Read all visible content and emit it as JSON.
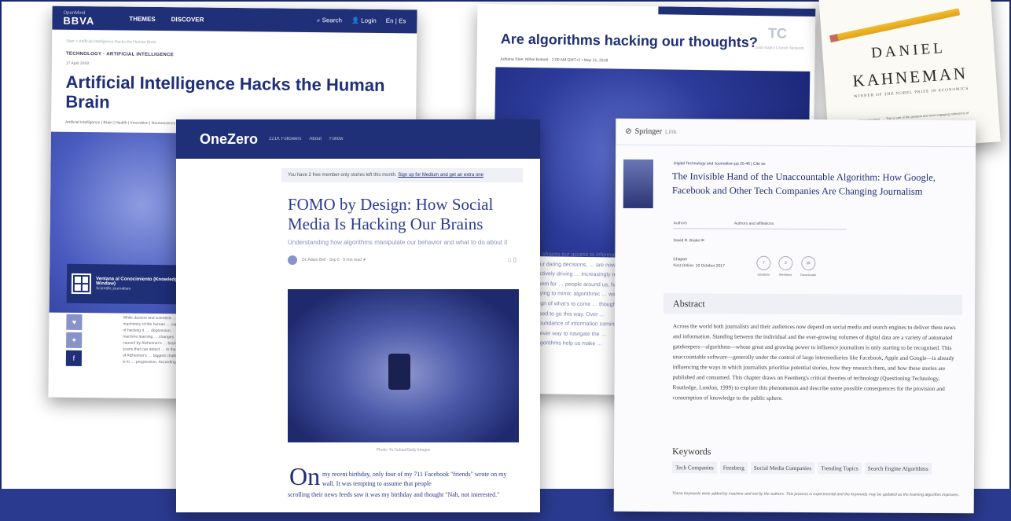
{
  "bbva": {
    "brand_sup": "OpenMind",
    "brand_logo": "BBVA",
    "nav_themes": "THEMES",
    "nav_discover": "DISCOVER",
    "nav_search": "Search",
    "nav_login": "Login",
    "nav_lang": "En | Es",
    "breadcrumb": "Start > Artificial Intelligence Hacks the Human Brain",
    "tags": "TECHNOLOGY · ARTIFICIAL INTELLIGENCE",
    "date": "17 April 2018",
    "title": "Artificial Intelligence Hacks the Human Brain",
    "categories": "Artificial Intelligence | Brain | Health | Innovation | Neuroscience",
    "author_name": "Ventana al Conocimiento (Knowledge Window)",
    "author_role": "Scientific journalism",
    "body": "While doctors and scientists … machinery of the human … capable of hacking it. … depression, machine learning … changes caused by Alzheimer's … brain scans that can detect … In the case of Alzheimer's … biggest challenge is to … progression. Accordingly …"
  },
  "algo": {
    "title": "Are algorithms hacking our thoughts?",
    "tc_logo": "TC",
    "tc_author": "Josh Kaltro Crunch Network",
    "authors": "Adriana Stan, Mihai Botarel · 2:00 AM GMT+2 • May 21, 2018",
    "text": "…shapes our access to information … our dating decisions, … are now actively driving … increasingly rely on them for … people around us, have … trying to mimic algorithmic … warning sign of what's to come … thoughts? … used to go this way. Over … abundance of information coming … a clever way to navigate the … algorithms help us make …"
  },
  "book": {
    "first_name": "DANIEL",
    "last_name": "KAHNEMAN",
    "prize": "WINNER OF THE NOBEL PRIZE IN ECONOMICS",
    "quote": "\"A masterpiece . . . This is one of the greatest and most engaging collections of"
  },
  "onezero": {
    "logo": "OneZero",
    "followers": "221K Followers",
    "about": "About",
    "follow": "Follow",
    "notice": "You have 2 free member-only stories left this month.",
    "notice_link": "Sign up for Medium and get an extra one",
    "title": "FOMO by Design: How Social Media Is Hacking Our Brains",
    "subtitle": "Understanding how algorithms manipulate our behavior and what to do about it",
    "meta": "Dr. Adam Bell · Sep 6 · 8 min read ★",
    "photo_credit": "Photo: Yu Xuhao/Getty Images",
    "drop_cap": "On",
    "lead_first": "my recent birthday, only four of my 711 Facebook \"friends\" wrote on my wall. It was tempting to assume that people",
    "lead_rest": "scrolling their news feeds saw it was my birthday and thought \"Nah, not interested.\""
  },
  "springer": {
    "brand": "Springer",
    "brand_link": "Link",
    "source": "Digital Technology and Journalism pp 25-46 | Cite as",
    "title": "The Invisible Hand of the Unaccountable Algorithm: How Google, Facebook and Other Tech Companies Are Changing Journalism",
    "tab_authors": "Authors",
    "tab_affiliations": "Authors and affiliations",
    "author": "David R. Brake ✉",
    "chapter_label": "Chapter",
    "first_online": "First Online: 10 October 2017",
    "metrics": [
      {
        "value": "7",
        "label": "Citations"
      },
      {
        "value": "2",
        "label": "Mentions"
      },
      {
        "value": "1k",
        "label": "Downloads"
      }
    ],
    "abstract_heading": "Abstract",
    "abstract": "Across the world both journalists and their audiences now depend on social media and search engines to deliver them news and information. Standing between the individual and the ever-growing volumes of digital data are a variety of automated gatekeepers—algorithms—whose great and growing power to influence journalism is only starting to be recognised. This unaccountable software—generally under the control of large intermediaries like Facebook, Apple and Google—is already influencing the ways in which journalists prioritise potential stories, how they research them, and how these stories are published and consumed. This chapter draws on Feenberg's critical theories of technology (Questioning Technology, Routledge, London, 1999) to explore this phenomenon and describe some possible consequences for the provision and consumption of knowledge to the public sphere.",
    "keywords_heading": "Keywords",
    "keywords": [
      "Tech Companies",
      "Feenberg",
      "Social Media Companies",
      "Trending Topics",
      "Search Engine Algorithms"
    ],
    "keywords_note": "These keywords were added by machine and not by the authors. This process is experimental and the keywords may be updated as the learning algorithm improves."
  },
  "colors": {
    "navy": "#1f2f78",
    "band": "#2a3a8f"
  }
}
